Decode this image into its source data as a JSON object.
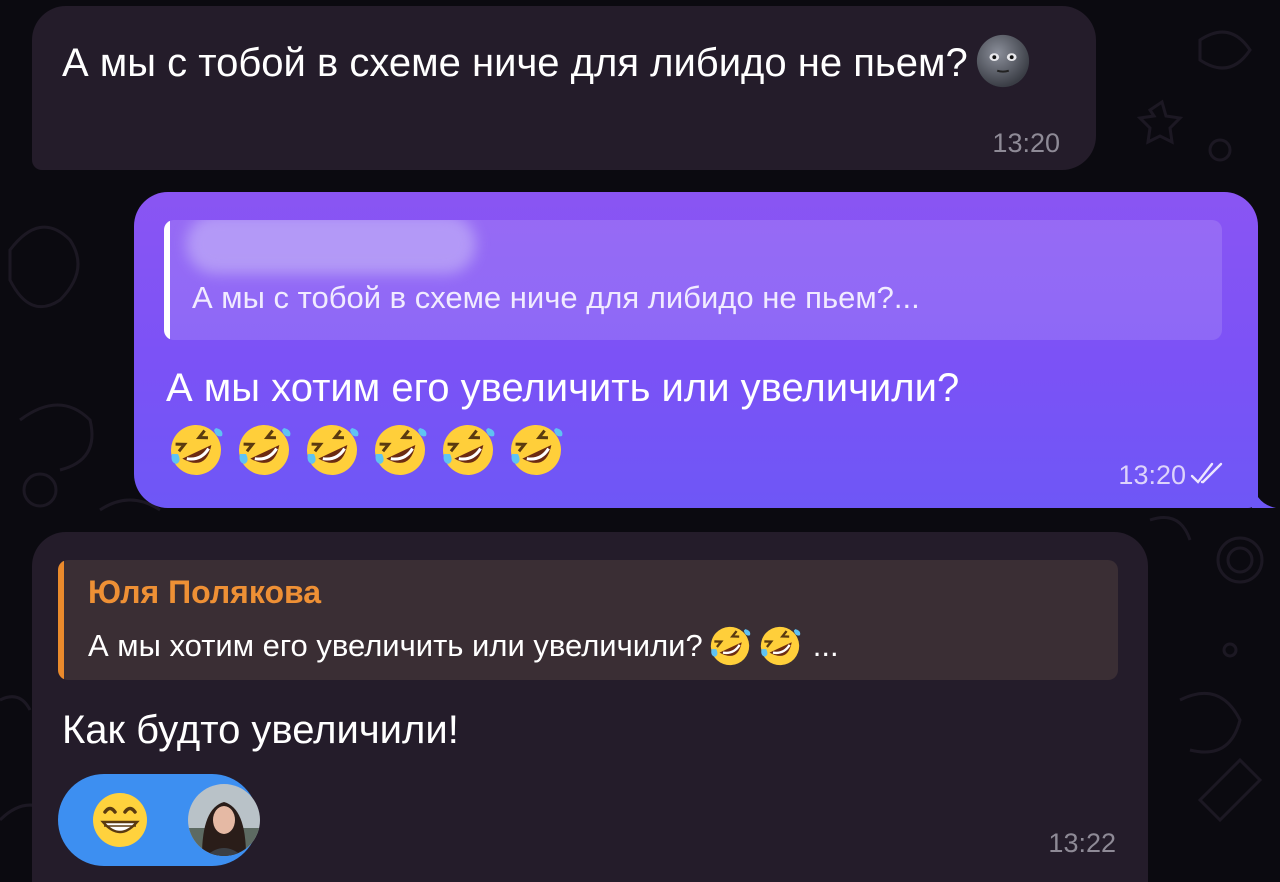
{
  "messages": {
    "first": {
      "text": "А мы с тобой в схеме ниче для либидо не пьем?",
      "emoji": "new-moon-face",
      "time": "13:20"
    },
    "second": {
      "reply_quote": "А мы с тобой в схеме ниче для либидо не пьем?...",
      "text": "А мы хотим его увеличить или увеличили?",
      "emoji": "rolling-on-floor-laughing",
      "emoji_count": 6,
      "time": "13:20",
      "status": "read"
    },
    "third": {
      "reply_name": "Юля Полякова",
      "reply_quote": "А мы хотим его увеличить или увеличили?",
      "reply_ellipsis": "...",
      "text": "Как будто увеличили!",
      "reaction_emoji": "beaming-face",
      "time": "13:22"
    }
  },
  "colors": {
    "background": "#0b0a10",
    "incoming_bubble": "#241c2a",
    "outgoing_bubble": "#7b52f6",
    "reply_accent": "#ea8a2c",
    "reaction_chip": "#3d8ff1"
  }
}
